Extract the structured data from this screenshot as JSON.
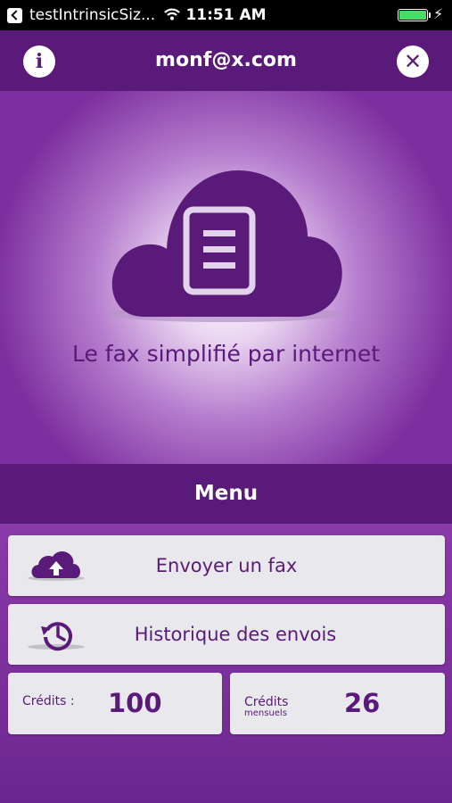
{
  "statusbar": {
    "app_name": "testIntrinsicSiz...",
    "time": "11:51 AM"
  },
  "navbar": {
    "title": "monf@x.com",
    "info_label": "i",
    "close_label": "✕"
  },
  "hero": {
    "tagline": "Le fax simplifié par internet"
  },
  "menu": {
    "title": "Menu",
    "send_fax_label": "Envoyer un fax",
    "history_label": "Historique des envois"
  },
  "credits": {
    "label": "Crédits :",
    "value": "100",
    "monthly_label": "Crédits",
    "monthly_sub": "mensuels",
    "monthly_value": "26"
  },
  "colors": {
    "primary": "#5a1a79",
    "background": "#7a2f9a",
    "card": "#e9e8ec",
    "battery": "#4cd964"
  },
  "icons": {
    "info": "info-icon",
    "close": "close-icon",
    "cloud_document": "cloud-document-icon",
    "upload": "cloud-upload-icon",
    "history": "history-icon"
  }
}
